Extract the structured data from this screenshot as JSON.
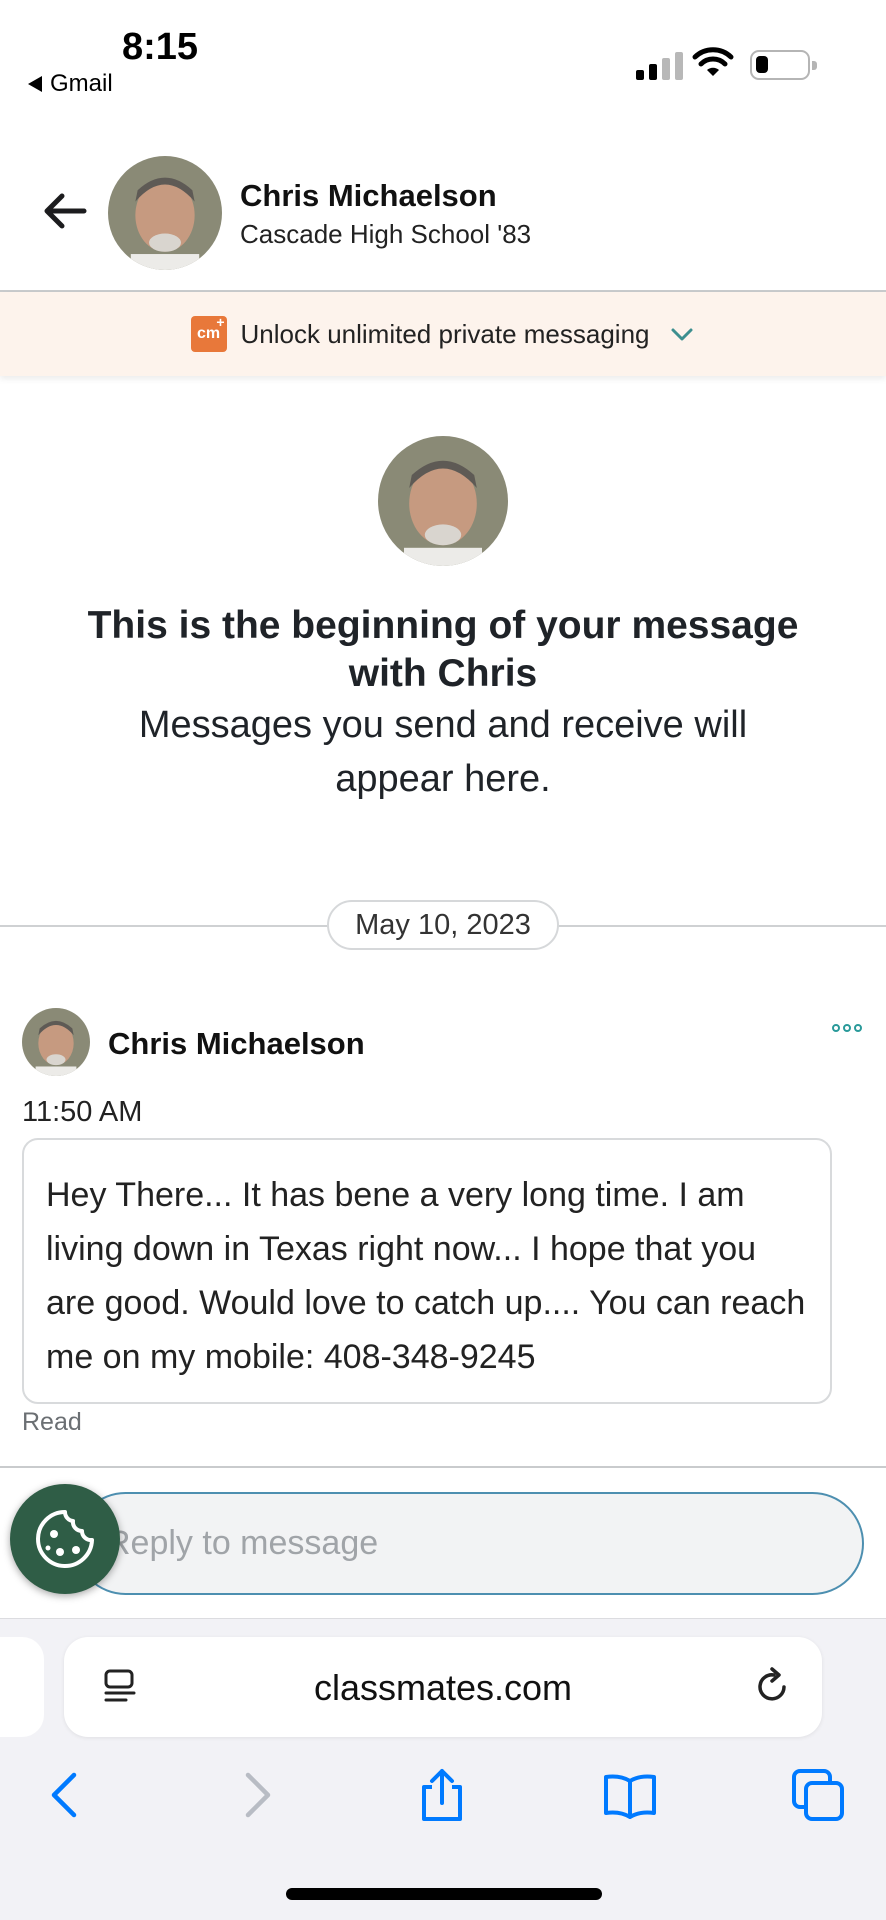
{
  "status_bar": {
    "time": "8:15",
    "back_app": "Gmail"
  },
  "header": {
    "name": "Chris Michaelson",
    "subtitle": "Cascade High School '83"
  },
  "promo": {
    "badge": "cm",
    "text": "Unlock unlimited private messaging"
  },
  "intro": {
    "title": "This is the beginning of your message with Chris",
    "subtitle": "Messages you send and receive will appear here."
  },
  "date_divider": "May 10, 2023",
  "message": {
    "sender": "Chris Michaelson",
    "time": "11:50 AM",
    "body": "Hey There... It has bene a very long time. I am living down in Texas right now... I hope that you are good. Would love to catch up.... You can reach me on my mobile: 408-348-9245",
    "status": "Read"
  },
  "reply": {
    "placeholder": "Reply to message"
  },
  "browser": {
    "url": "classmates.com"
  },
  "colors": {
    "promo_bg": "#fdf3ec",
    "brand_orange": "#e8783a",
    "accent_teal": "#2a9a9a",
    "input_border": "#4d8fb0",
    "cookie_green": "#2f5d46",
    "ios_blue": "#007aff"
  }
}
